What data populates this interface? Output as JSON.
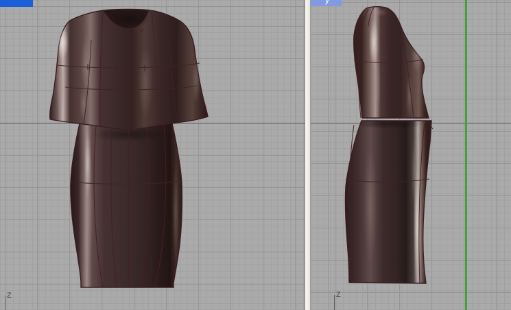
{
  "viewports": [
    {
      "id": "front",
      "title": "",
      "axis_label": "Z"
    },
    {
      "id": "side",
      "title": "y",
      "axis_label": "Z"
    }
  ],
  "scene": {
    "object": "two-piece dress model (cropped-sleeve jacket and pencil skirt)",
    "views": [
      "front elevation",
      "side elevation"
    ]
  },
  "colors": {
    "viewport_background": "#aaaaaa",
    "grid_minor": "#a2a2a2",
    "grid_major": "#959595",
    "ground_axis_line": "#7d7d7d",
    "vertical_world_axis_green": "#3fa23f",
    "active_tab_blue": "#1c5ed7",
    "inactive_tab_blue": "#8399e2",
    "divider_fill": "#f4f3ec",
    "model_surface_base": "#392726",
    "model_wireframe": "#432028",
    "model_specular": "#d8ccc8",
    "axis_gizmo_gray": "#5c5c5c"
  }
}
